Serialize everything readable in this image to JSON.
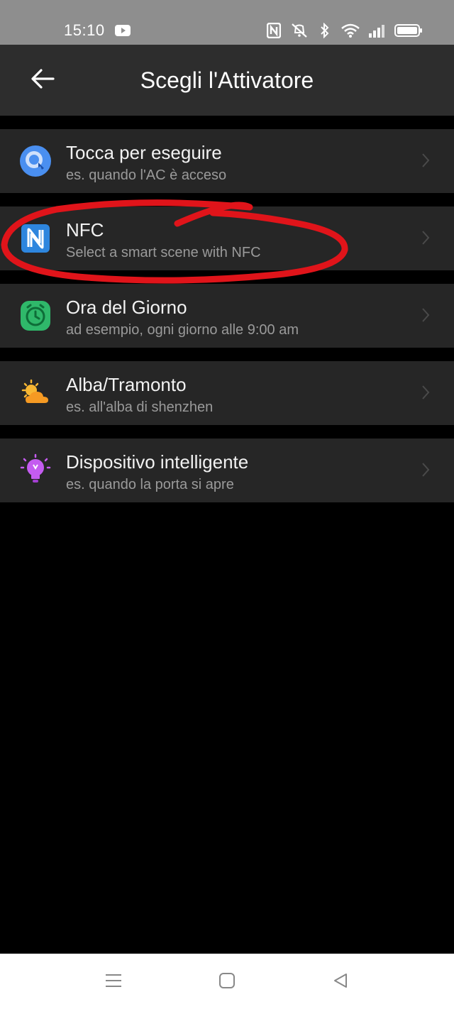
{
  "status_bar": {
    "time": "15:10",
    "icons": [
      "youtube-icon",
      "nfc-icon",
      "mute-icon",
      "bluetooth-icon",
      "wifi-icon",
      "signal-icon",
      "battery-icon"
    ]
  },
  "header": {
    "title": "Scegli l'Attivatore",
    "back_icon": "arrow-left-icon"
  },
  "triggers": [
    {
      "title": "Tocca per eseguire",
      "subtitle": "es. quando l'AC è acceso",
      "icon": "tap-run-icon",
      "color": "#4a8ff0"
    },
    {
      "title": "NFC",
      "subtitle": "Select a smart scene with NFC",
      "icon": "nfc-icon",
      "color": "#2e86de"
    },
    {
      "title": "Ora del Giorno",
      "subtitle": "ad esempio, ogni giorno alle 9:00 am",
      "icon": "clock-icon",
      "color": "#2fb86a"
    },
    {
      "title": "Alba/Tramonto",
      "subtitle": "es. all'alba di shenzhen",
      "icon": "sun-cloud-icon",
      "color": "#f5a623"
    },
    {
      "title": "Dispositivo intelligente",
      "subtitle": "es. quando la porta si apre",
      "icon": "lightbulb-icon",
      "color": "#b84ee0"
    }
  ],
  "annotation": {
    "shape": "hand-drawn-ellipse",
    "target": "NFC",
    "color": "#e0141a"
  },
  "nav_bar": {
    "icons": [
      "menu-icon",
      "home-icon",
      "back-triangle-icon"
    ]
  }
}
